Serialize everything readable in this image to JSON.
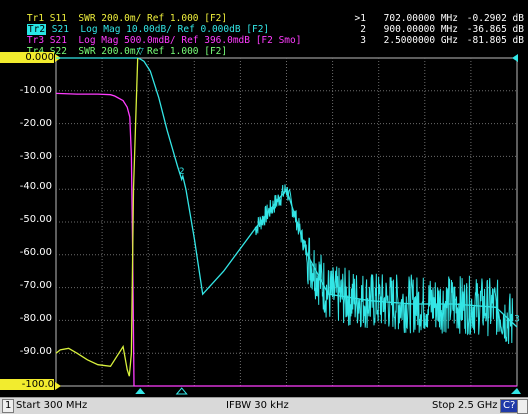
{
  "traces": [
    {
      "label": "Tr1",
      "text": "S11  SWR 200.0m/ Ref 1.000 [F2]",
      "color": "#f0f03c"
    },
    {
      "label": "Tr2",
      "text": "S21  Log Mag 10.00dB/ Ref 0.000dB [F2]",
      "color": "#33e6e6"
    },
    {
      "label": "Tr3",
      "text": "S21  Log Mag 500.0mdB/ Ref 396.0mdB [F2 Smo]",
      "color": "#ff3cff"
    },
    {
      "label": "Tr4",
      "text": "S22  SWR 200.0m/ Ref 1.000 [F2]",
      "color": "#78ff78"
    }
  ],
  "markers": [
    {
      "id": ">1",
      "freq": "702.00000 MHz",
      "value": "-0.2902 dB"
    },
    {
      "id": "2",
      "freq": "900.00000 MHz",
      "value": "-36.865 dB"
    },
    {
      "id": "3",
      "freq": "2.5000000 GHz",
      "value": "-81.805 dB"
    }
  ],
  "y_axis": {
    "labels": [
      "0.000",
      "-10.00",
      "-20.00",
      "-30.00",
      "-40.00",
      "-50.00",
      "-60.00",
      "-70.00",
      "-80.00",
      "-90.00",
      "-100.0"
    ]
  },
  "status_bar": {
    "channel": "1",
    "start": "Start 300 MHz",
    "ifbw": "IFBW 30 kHz",
    "stop": "Stop 2.5 GHz",
    "cal": "C?"
  },
  "chart_data": {
    "type": "line",
    "xlabel": "",
    "ylabel": "",
    "xlim": [
      300,
      2500
    ],
    "ylim": [
      -100,
      0
    ],
    "grid": true,
    "series": [
      {
        "trace": "Tr2",
        "color": "#33e6e6",
        "x": [
          300,
          550,
          650,
          690,
          702,
          720,
          750,
          790,
          830,
          880,
          900,
          905,
          920,
          960,
          1000,
          1100,
          1250,
          1400,
          1500,
          1600,
          1800,
          2000,
          2200,
          2400,
          2500
        ],
        "y": [
          0,
          0,
          0,
          0,
          -0.29,
          -1,
          -4,
          -12,
          -22,
          -33,
          -37,
          -36,
          -40,
          -55,
          -72,
          -65,
          -52,
          -40,
          -60,
          -72,
          -74,
          -75,
          -75,
          -76,
          -82
        ]
      },
      {
        "trace": "Tr3",
        "color": "#ff3cff",
        "x": [
          300,
          400,
          500,
          560,
          580,
          620,
          640,
          652,
          660,
          666,
          672,
          690,
          2500
        ],
        "y": [
          -10.8,
          -11.0,
          -11.0,
          -11.2,
          -11.6,
          -13,
          -15,
          -18,
          -30,
          -60,
          -100,
          -100,
          -100
        ]
      },
      {
        "trace": "Tr1/Tr4",
        "color": "#d8f03c",
        "x": [
          300,
          320,
          360,
          400,
          450,
          500,
          560,
          600,
          620,
          640,
          650,
          660,
          670,
          690
        ],
        "y": [
          -90,
          -89,
          -88.5,
          -90,
          -92,
          -93.5,
          -94,
          -90,
          -88,
          -95,
          -97,
          -90,
          -40,
          0
        ]
      }
    ]
  }
}
